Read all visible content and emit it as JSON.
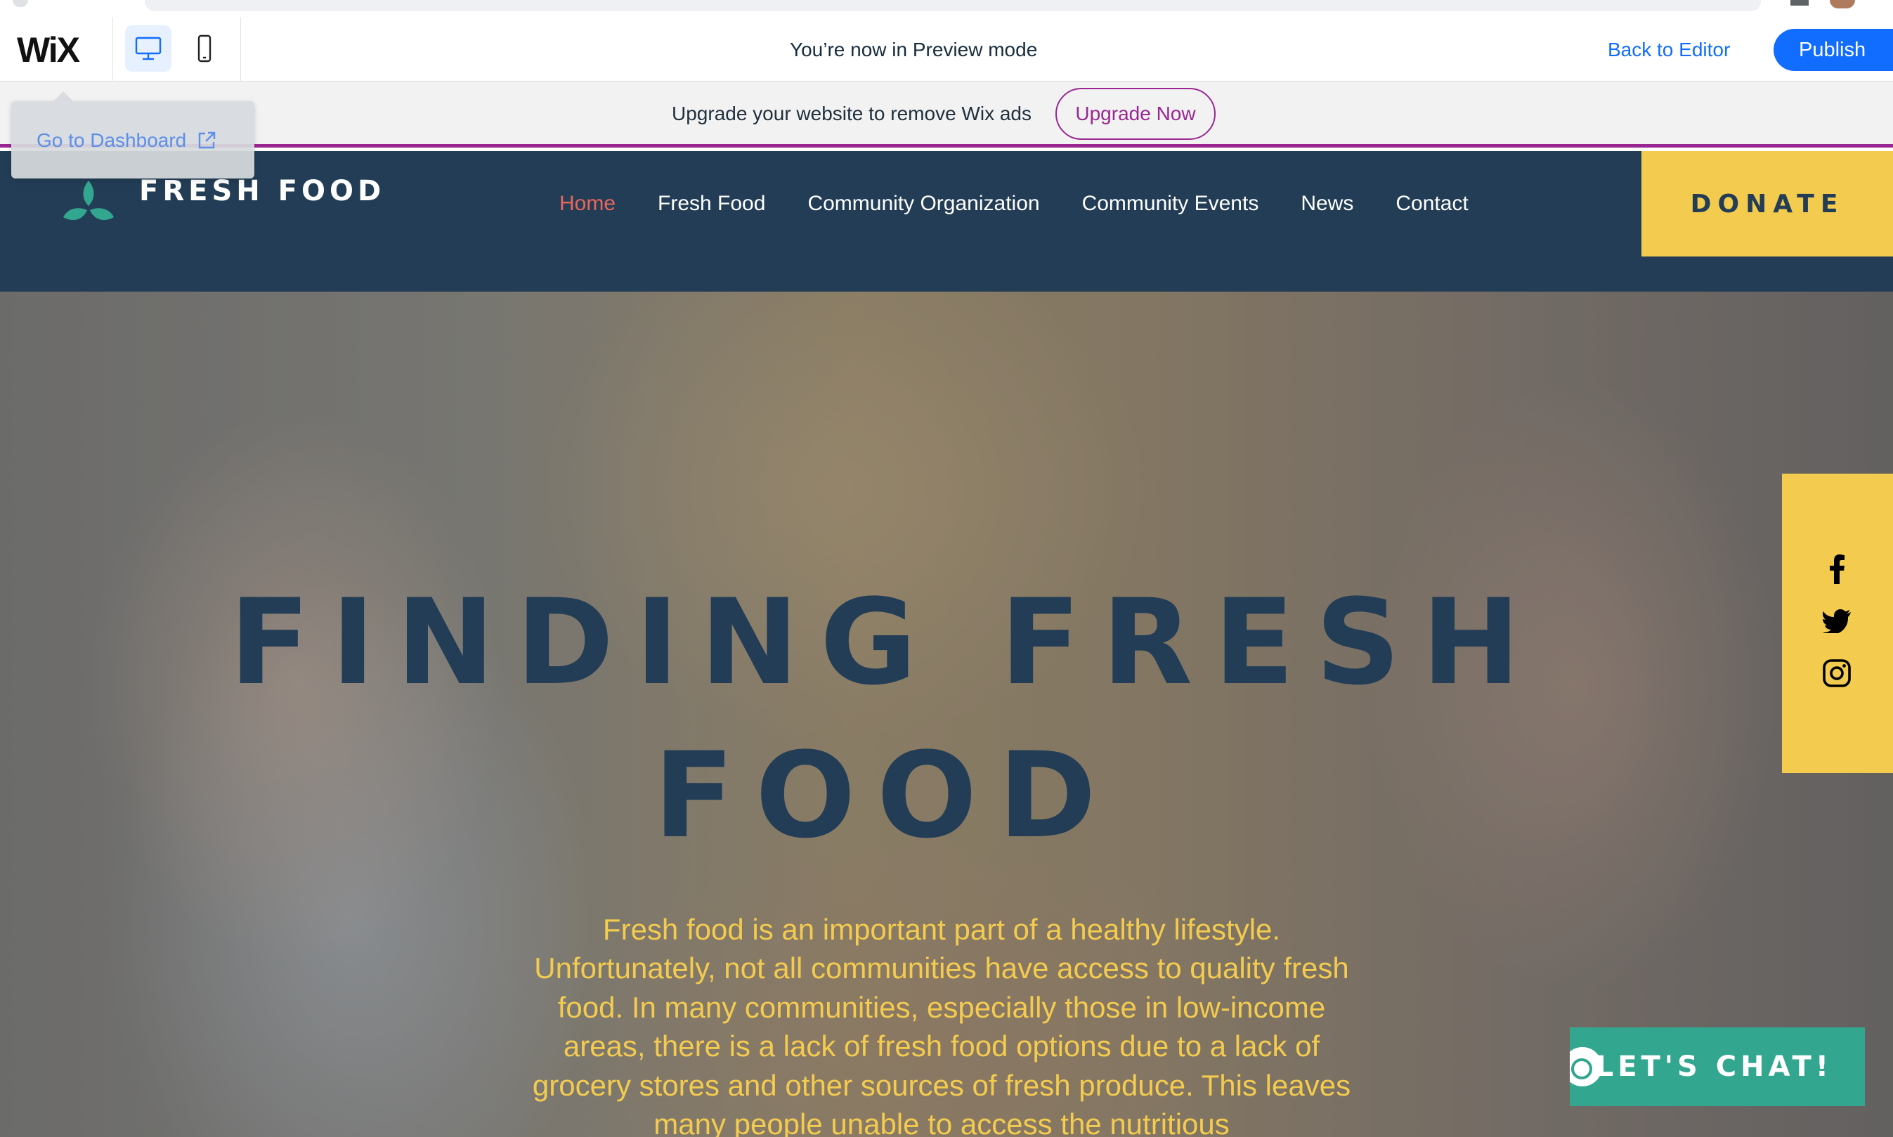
{
  "wix_bar": {
    "logo": "WiX",
    "preview_message": "You’re now in Preview mode",
    "back_to_editor": "Back to Editor",
    "publish": "Publish",
    "devices": [
      "desktop-icon",
      "mobile-icon"
    ]
  },
  "dashboard_popover": {
    "label": "Go to Dashboard"
  },
  "upgrade_banner": {
    "text": "Upgrade your website to remove Wix ads",
    "button": "Upgrade Now"
  },
  "site": {
    "logo_text": "FRESH FOOD",
    "nav": [
      {
        "label": "Home",
        "active": true
      },
      {
        "label": "Fresh Food",
        "active": false
      },
      {
        "label": "Community Organization",
        "active": false
      },
      {
        "label": "Community Events",
        "active": false
      },
      {
        "label": "News",
        "active": false
      },
      {
        "label": "Contact",
        "active": false
      }
    ],
    "donate": "DONATE"
  },
  "hero": {
    "title_line1": "FINDING FRESH",
    "title_line2": "FOOD",
    "body": "Fresh food is an important part of a healthy lifestyle. Unfortunately, not all communities have access to quality fresh food. In many communities, especially those in low-income areas, there is a lack of fresh food options due to a lack of grocery stores and other sources of fresh produce. This leaves many people unable to access the nutritious"
  },
  "social": [
    "facebook-icon",
    "twitter-icon",
    "instagram-icon"
  ],
  "chat": {
    "label": "LET'S CHAT!"
  },
  "colors": {
    "wix_blue": "#116dff",
    "upgrade_purple": "#9a2791",
    "site_navy": "#223d55",
    "accent_yellow": "#f3cb4f",
    "nav_active": "#e8665c",
    "chat_green": "#33a68f"
  }
}
